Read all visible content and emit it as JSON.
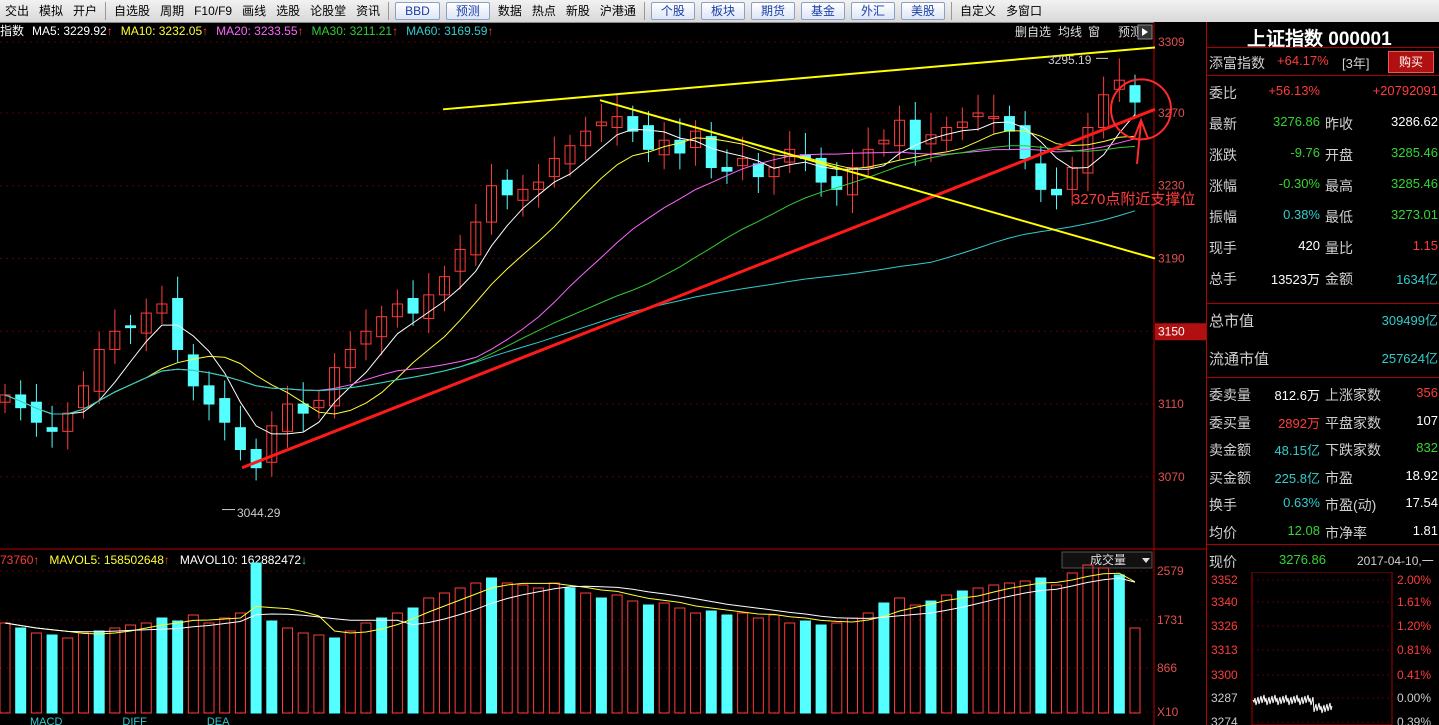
{
  "toolbar": {
    "items": [
      "交出",
      "模拟",
      "开户",
      "自选股",
      "周期",
      "F10/F9",
      "画线",
      "选股",
      "论股堂",
      "资讯",
      "BBD",
      "预测",
      "数据",
      "热点",
      "新股",
      "沪港通",
      "个股",
      "板块",
      "期货",
      "基金",
      "外汇",
      "美股",
      "自定义",
      "多窗口"
    ]
  },
  "kline": {
    "header_prefix": "指数",
    "ma": [
      {
        "label": "MA5: 3229.92",
        "arrow": "↑",
        "color": "#ffffff"
      },
      {
        "label": "MA10: 3232.05",
        "arrow": "↑",
        "color": "#ffff33"
      },
      {
        "label": "MA20: 3233.55",
        "arrow": "↑",
        "color": "#ff66ff"
      },
      {
        "label": "MA30: 3211.21",
        "arrow": "↑",
        "color": "#33cc33"
      },
      {
        "label": "MA60: 3169.59",
        "arrow": "↑",
        "color": "#33cccc"
      }
    ],
    "tools": [
      "删自选",
      "均线",
      "窗",
      "预测"
    ],
    "price_axis": [
      "3309",
      "3270",
      "3230",
      "3190",
      "3150",
      "3110",
      "3070"
    ],
    "current_price_tag": "3150",
    "high_label": "3295.19",
    "low_label": "3044.29",
    "annotation": "3270点附近支撑位",
    "colors": {
      "up": "#ff3c3c",
      "down": "#54ffff",
      "trend_red": "#ff1a1a",
      "trend_yellow": "#ffff00"
    }
  },
  "volume": {
    "header": [
      {
        "label": "73760",
        "arrow": "↑",
        "color": "#ff3c3c"
      },
      {
        "label": "MAVOL5: 158502648",
        "arrow": "↑",
        "color": "#ffff33"
      },
      {
        "label": "MAVOL10: 162882472",
        "arrow": "↓",
        "color": "#ffffff"
      }
    ],
    "dropdown": "成交量",
    "axis": [
      "2579",
      "1731",
      "866",
      "X10"
    ]
  },
  "bottom_strip": [
    "MACD",
    "DIFF",
    "DEA"
  ],
  "info": {
    "title": "上证指数 000001",
    "tianfu_label": "添富指数",
    "tianfu_value": "+64.17%",
    "tianfu_period": "[3年]",
    "buy_label": "购买",
    "rows": [
      {
        "l": "委比",
        "v": "+56.13%",
        "vc": "red",
        "l2": "",
        "v2": "+20792091",
        "v2c": "red"
      },
      {
        "l": "最新",
        "v": "3276.86",
        "vc": "green",
        "l2": "昨收",
        "v2": "3286.62",
        "v2c": "white"
      },
      {
        "l": "涨跌",
        "v": "-9.76",
        "vc": "green",
        "l2": "开盘",
        "v2": "3285.46",
        "v2c": "green"
      },
      {
        "l": "涨幅",
        "v": "-0.30%",
        "vc": "green",
        "l2": "最高",
        "v2": "3285.46",
        "v2c": "green"
      },
      {
        "l": "振幅",
        "v": "0.38%",
        "vc": "cyan",
        "l2": "最低",
        "v2": "3273.01",
        "v2c": "green"
      },
      {
        "l": "现手",
        "v": "420",
        "vc": "white",
        "l2": "量比",
        "v2": "1.15",
        "v2c": "red"
      },
      {
        "l": "总手",
        "v": "13523万",
        "vc": "white",
        "l2": "金额",
        "v2": "1634亿",
        "v2c": "cyan"
      }
    ],
    "market_cap": [
      {
        "l": "总市值",
        "v": "309499亿"
      },
      {
        "l": "流通市值",
        "v": "257624亿"
      }
    ],
    "rows2": [
      {
        "l": "委卖量",
        "v": "812.6万",
        "vc": "white",
        "l2": "上涨家数",
        "v2": "356",
        "v2c": "red"
      },
      {
        "l": "委买量",
        "v": "2892万",
        "vc": "red",
        "l2": "平盘家数",
        "v2": "107",
        "v2c": "white"
      },
      {
        "l": "卖金额",
        "v": "48.15亿",
        "vc": "cyan",
        "l2": "下跌家数",
        "v2": "832",
        "v2c": "green"
      },
      {
        "l": "买金额",
        "v": "225.8亿",
        "vc": "cyan",
        "l2": "市盈",
        "v2": "18.92",
        "v2c": "white"
      },
      {
        "l": "换手",
        "v": "0.63%",
        "vc": "cyan",
        "l2": "市盈(动)",
        "v2": "17.54",
        "v2c": "white"
      },
      {
        "l": "均价",
        "v": "12.08",
        "vc": "green",
        "l2": "市净率",
        "v2": "1.81",
        "v2c": "white"
      }
    ],
    "price_row": {
      "l": "现价",
      "v": "3276.86",
      "date": "2017-04-10,一"
    },
    "mini_left": [
      "3352",
      "3340",
      "3326",
      "3313",
      "3300",
      "3287",
      "3274"
    ],
    "mini_right": [
      "2.00%",
      "1.61%",
      "1.20%",
      "0.81%",
      "0.41%",
      "0.00%",
      "0.39%"
    ]
  }
}
